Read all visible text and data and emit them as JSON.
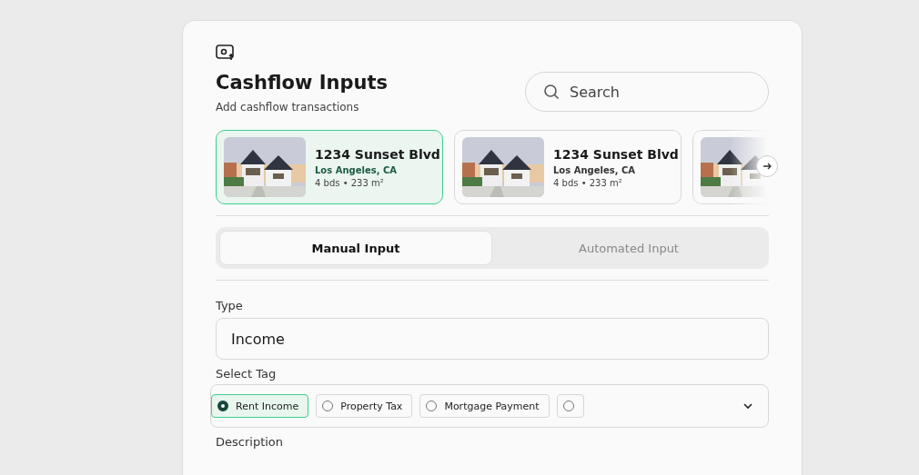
{
  "title": "Cashflow Inputs",
  "subtitle": "Add cashflow transactions",
  "search": {
    "placeholder": "Search"
  },
  "properties": [
    {
      "address": "1234 Sunset Blvd",
      "city": "Los Angeles, CA",
      "details": "4 bds • 233 m²",
      "selected": true
    },
    {
      "address": "1234 Sunset Blvd",
      "city": "Los Angeles, CA",
      "details": "4 bds • 233 m²",
      "selected": false
    },
    {
      "selected": false
    }
  ],
  "tabs": [
    {
      "label": "Manual Input",
      "selected": true
    },
    {
      "label": "Automated Input",
      "selected": false
    }
  ],
  "type_field": {
    "label": "Type",
    "value": "Income"
  },
  "tag_field": {
    "label": "Select Tag",
    "options": [
      {
        "label": "Rent Income",
        "selected": true
      },
      {
        "label": "Property Tax",
        "selected": false
      },
      {
        "label": "Mortgage Payment",
        "selected": false
      },
      {
        "selected": false
      }
    ]
  },
  "description": {
    "label": "Description"
  }
}
